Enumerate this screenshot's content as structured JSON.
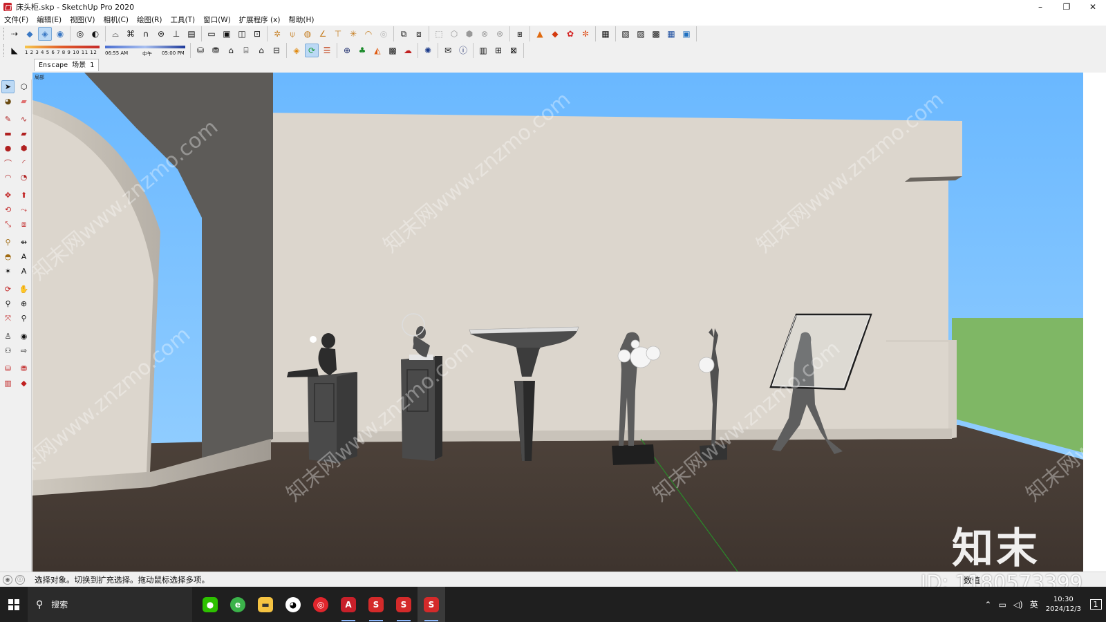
{
  "window": {
    "title": "床头柜.skp - SketchUp Pro 2020",
    "controls": [
      "–",
      "❐",
      "✕"
    ]
  },
  "menu": [
    "文件(F)",
    "编辑(E)",
    "视图(V)",
    "相机(C)",
    "绘图(R)",
    "工具(T)",
    "窗口(W)",
    "扩展程序 (x)",
    "帮助(H)"
  ],
  "shadow": {
    "months": "1 2 3 4 5 6 7 8 9 10 11 12",
    "time_start": "06:55 AM",
    "time_mid": "中午",
    "time_end": "05:00 PM"
  },
  "scene_tab": "Enscape 场景 1",
  "viewport": {
    "label": "局部"
  },
  "watermark": {
    "logo": "知末",
    "site": "知末网www.znzmo.com"
  },
  "status": {
    "hint": "选择对象。切换到扩充选择。拖动鼠标选择多项。",
    "vcb_label": "数值"
  },
  "id_text": "ID: 1180573399",
  "taskbar": {
    "search": "搜索",
    "apps": [
      {
        "name": "wechat",
        "glyph": "●",
        "color": "#2dc100"
      },
      {
        "name": "browser",
        "glyph": "e",
        "color": "#3bb34a"
      },
      {
        "name": "explorer",
        "glyph": "▬",
        "color": "#f5c342"
      },
      {
        "name": "qq",
        "glyph": "◕",
        "color": "#1b1b1b"
      },
      {
        "name": "netease",
        "glyph": "◎",
        "color": "#e0252c"
      },
      {
        "name": "autocad",
        "glyph": "A",
        "color": "#c8202a"
      },
      {
        "name": "sketchup-a",
        "glyph": "S",
        "color": "#d42a2a"
      },
      {
        "name": "sketchup-b",
        "glyph": "S",
        "color": "#d42a2a"
      },
      {
        "name": "sketchup-c",
        "glyph": "S",
        "color": "#d42a2a"
      }
    ],
    "ime": "英",
    "time": "10:30",
    "date": "2024/12/3",
    "notif_count": "1"
  },
  "colors": {
    "sky": "#7cc3ff",
    "wall": "#dcd6cd",
    "floor": "#4a3f38",
    "ground": "#7fb765",
    "sculpture": "#5a5a5a"
  }
}
